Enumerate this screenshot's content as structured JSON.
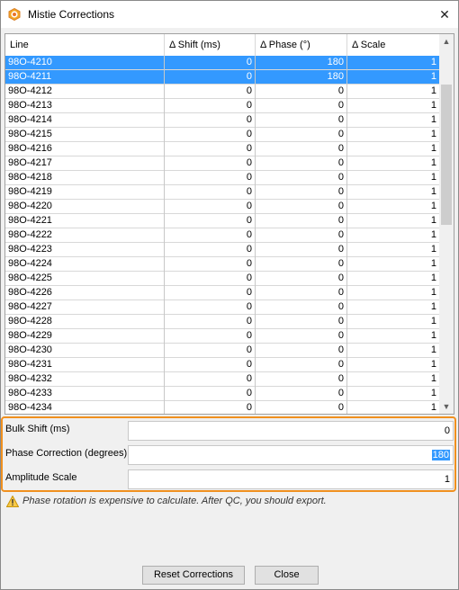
{
  "window": {
    "title": "Mistie Corrections",
    "close_glyph": "✕",
    "icon": "app-target-icon"
  },
  "table": {
    "columns": [
      "Line",
      "Δ Shift (ms)",
      "Δ Phase (°)",
      "Δ Scale"
    ],
    "rows": [
      {
        "line": "98O-4210",
        "shift": "0",
        "phase": "180",
        "scale": "1",
        "selected": true
      },
      {
        "line": "98O-4211",
        "shift": "0",
        "phase": "180",
        "scale": "1",
        "selected": true
      },
      {
        "line": "98O-4212",
        "shift": "0",
        "phase": "0",
        "scale": "1"
      },
      {
        "line": "98O-4213",
        "shift": "0",
        "phase": "0",
        "scale": "1"
      },
      {
        "line": "98O-4214",
        "shift": "0",
        "phase": "0",
        "scale": "1"
      },
      {
        "line": "98O-4215",
        "shift": "0",
        "phase": "0",
        "scale": "1"
      },
      {
        "line": "98O-4216",
        "shift": "0",
        "phase": "0",
        "scale": "1"
      },
      {
        "line": "98O-4217",
        "shift": "0",
        "phase": "0",
        "scale": "1"
      },
      {
        "line": "98O-4218",
        "shift": "0",
        "phase": "0",
        "scale": "1"
      },
      {
        "line": "98O-4219",
        "shift": "0",
        "phase": "0",
        "scale": "1"
      },
      {
        "line": "98O-4220",
        "shift": "0",
        "phase": "0",
        "scale": "1"
      },
      {
        "line": "98O-4221",
        "shift": "0",
        "phase": "0",
        "scale": "1"
      },
      {
        "line": "98O-4222",
        "shift": "0",
        "phase": "0",
        "scale": "1"
      },
      {
        "line": "98O-4223",
        "shift": "0",
        "phase": "0",
        "scale": "1"
      },
      {
        "line": "98O-4224",
        "shift": "0",
        "phase": "0",
        "scale": "1"
      },
      {
        "line": "98O-4225",
        "shift": "0",
        "phase": "0",
        "scale": "1"
      },
      {
        "line": "98O-4226",
        "shift": "0",
        "phase": "0",
        "scale": "1"
      },
      {
        "line": "98O-4227",
        "shift": "0",
        "phase": "0",
        "scale": "1"
      },
      {
        "line": "98O-4228",
        "shift": "0",
        "phase": "0",
        "scale": "1"
      },
      {
        "line": "98O-4229",
        "shift": "0",
        "phase": "0",
        "scale": "1"
      },
      {
        "line": "98O-4230",
        "shift": "0",
        "phase": "0",
        "scale": "1"
      },
      {
        "line": "98O-4231",
        "shift": "0",
        "phase": "0",
        "scale": "1"
      },
      {
        "line": "98O-4232",
        "shift": "0",
        "phase": "0",
        "scale": "1"
      },
      {
        "line": "98O-4233",
        "shift": "0",
        "phase": "0",
        "scale": "1"
      },
      {
        "line": "98O-4234",
        "shift": "0",
        "phase": "0",
        "scale": "1"
      }
    ],
    "scroll_up_glyph": "▲",
    "scroll_down_glyph": "▼"
  },
  "properties": {
    "bulk_shift": {
      "label": "Bulk Shift (ms)",
      "value": "0"
    },
    "phase_correction": {
      "label": "Phase Correction (degrees)",
      "value": "180"
    },
    "amplitude_scale": {
      "label": "Amplitude Scale",
      "value": "1"
    },
    "highlight_color": "#f0901f"
  },
  "warning": {
    "icon": "warning-icon",
    "text": "Phase rotation is expensive to calculate. After QC, you should export."
  },
  "buttons": {
    "reset": "Reset Corrections",
    "close": "Close"
  },
  "colors": {
    "selection": "#3399ff",
    "accent_orange": "#f0901f"
  }
}
